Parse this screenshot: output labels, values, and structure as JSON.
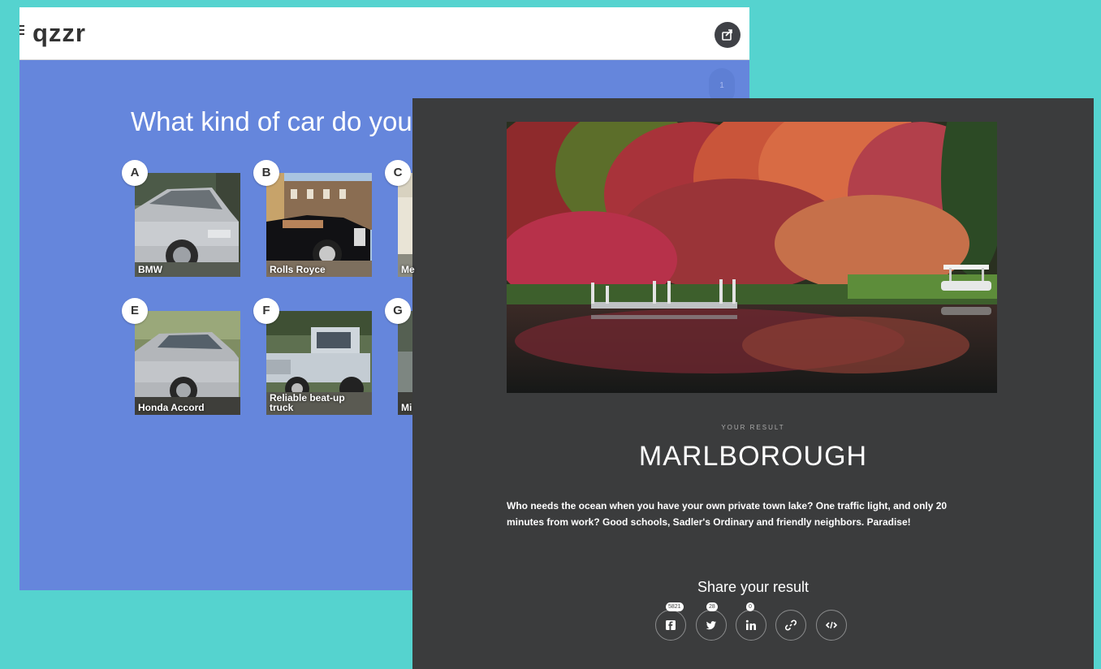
{
  "quiz": {
    "logo": "qzzr",
    "progress": "1",
    "question": "What kind of car do you d",
    "options": [
      {
        "letter": "A",
        "label": "BMW"
      },
      {
        "letter": "B",
        "label": "Rolls Royce"
      },
      {
        "letter": "C",
        "label": "Me"
      },
      {
        "letter": "E",
        "label": "Honda Accord"
      },
      {
        "letter": "F",
        "label": "Reliable beat-up truck"
      },
      {
        "letter": "G",
        "label": "Mi"
      }
    ]
  },
  "result": {
    "kicker": "YOUR RESULT",
    "title": "MARLBOROUGH",
    "description": "Who needs the ocean when you have your own private town lake? One traffic light, and only 20 minutes from work? Good schools, Sadler's Ordinary and friendly neighbors. Paradise!",
    "share_heading": "Share your result",
    "share": [
      {
        "network": "facebook",
        "icon": "facebook-icon",
        "count": "5821"
      },
      {
        "network": "twitter",
        "icon": "twitter-icon",
        "count": "28"
      },
      {
        "network": "linkedin",
        "icon": "linkedin-icon",
        "count": "0"
      },
      {
        "network": "link",
        "icon": "link-icon",
        "count": ""
      },
      {
        "network": "embed",
        "icon": "embed-icon",
        "count": ""
      }
    ]
  },
  "colors": {
    "background": "#55d3cf",
    "quiz_bg": "#6586dc",
    "result_bg": "#3b3c3d"
  }
}
